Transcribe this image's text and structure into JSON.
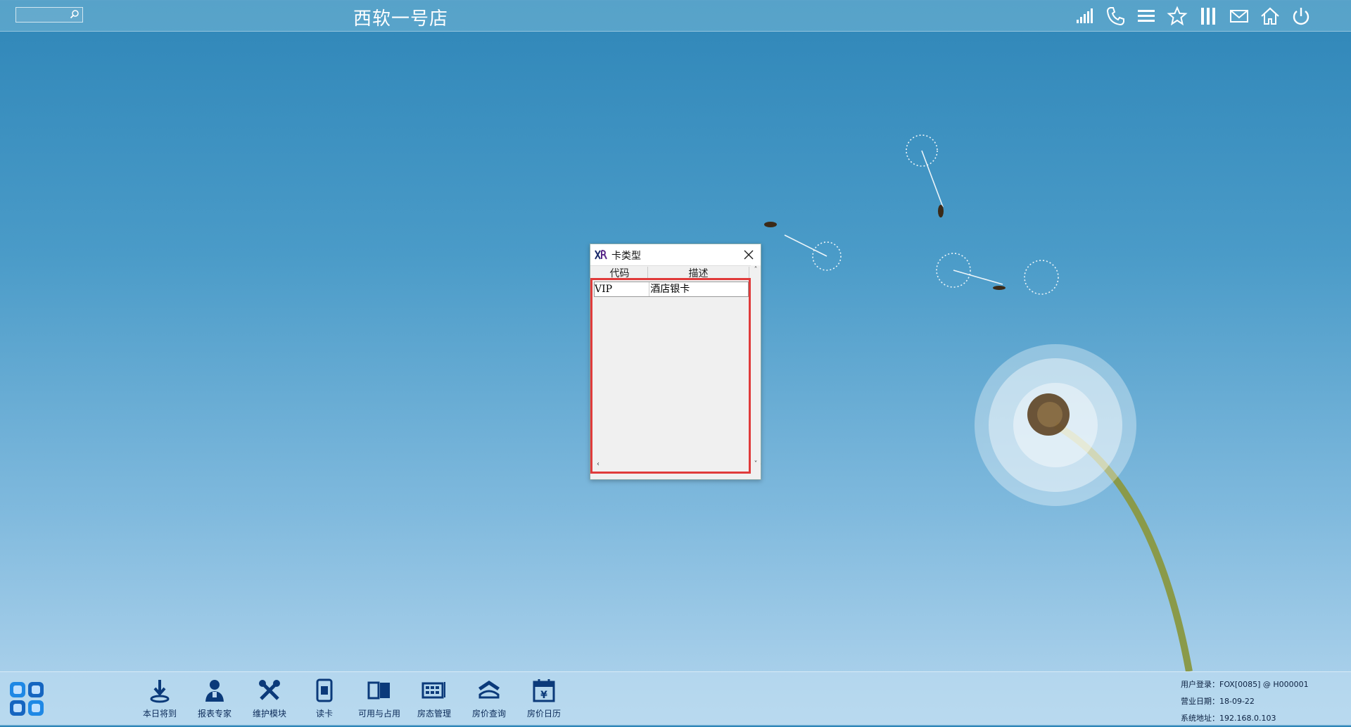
{
  "topbar": {
    "search_placeholder": "",
    "hotel_title": "西软一号店",
    "icons": [
      "signal-icon",
      "phone-icon",
      "menu-icon",
      "star-icon",
      "columns-icon",
      "mail-icon",
      "home-icon",
      "power-icon"
    ]
  },
  "dialog": {
    "title": "卡类型",
    "columns": [
      "代码",
      "描述"
    ],
    "rows": [
      {
        "code": "VIP",
        "desc": "酒店银卡"
      }
    ]
  },
  "taskbar": {
    "apps": [
      {
        "label": "本日将到",
        "icon": "arrival-icon"
      },
      {
        "label": "报表专家",
        "icon": "report-expert-icon"
      },
      {
        "label": "维护模块",
        "icon": "tools-icon"
      },
      {
        "label": "读卡",
        "icon": "card-reader-icon"
      },
      {
        "label": "可用与占用",
        "icon": "availability-icon"
      },
      {
        "label": "房态管理",
        "icon": "room-status-icon"
      },
      {
        "label": "房价查询",
        "icon": "rate-query-icon"
      },
      {
        "label": "房价日历",
        "icon": "rate-calendar-icon"
      }
    ],
    "status": {
      "user_login": "用户登录：FOX[0085] @ H000001",
      "business_date": "营业日期：18-09-22",
      "system_address": "系统地址：192.168.0.103"
    }
  },
  "colors": {
    "accent": "#0b3a7a",
    "highlight_border": "#e03b3b",
    "sky_top": "#2f86b8",
    "sky_bottom": "#b4d6ee"
  }
}
